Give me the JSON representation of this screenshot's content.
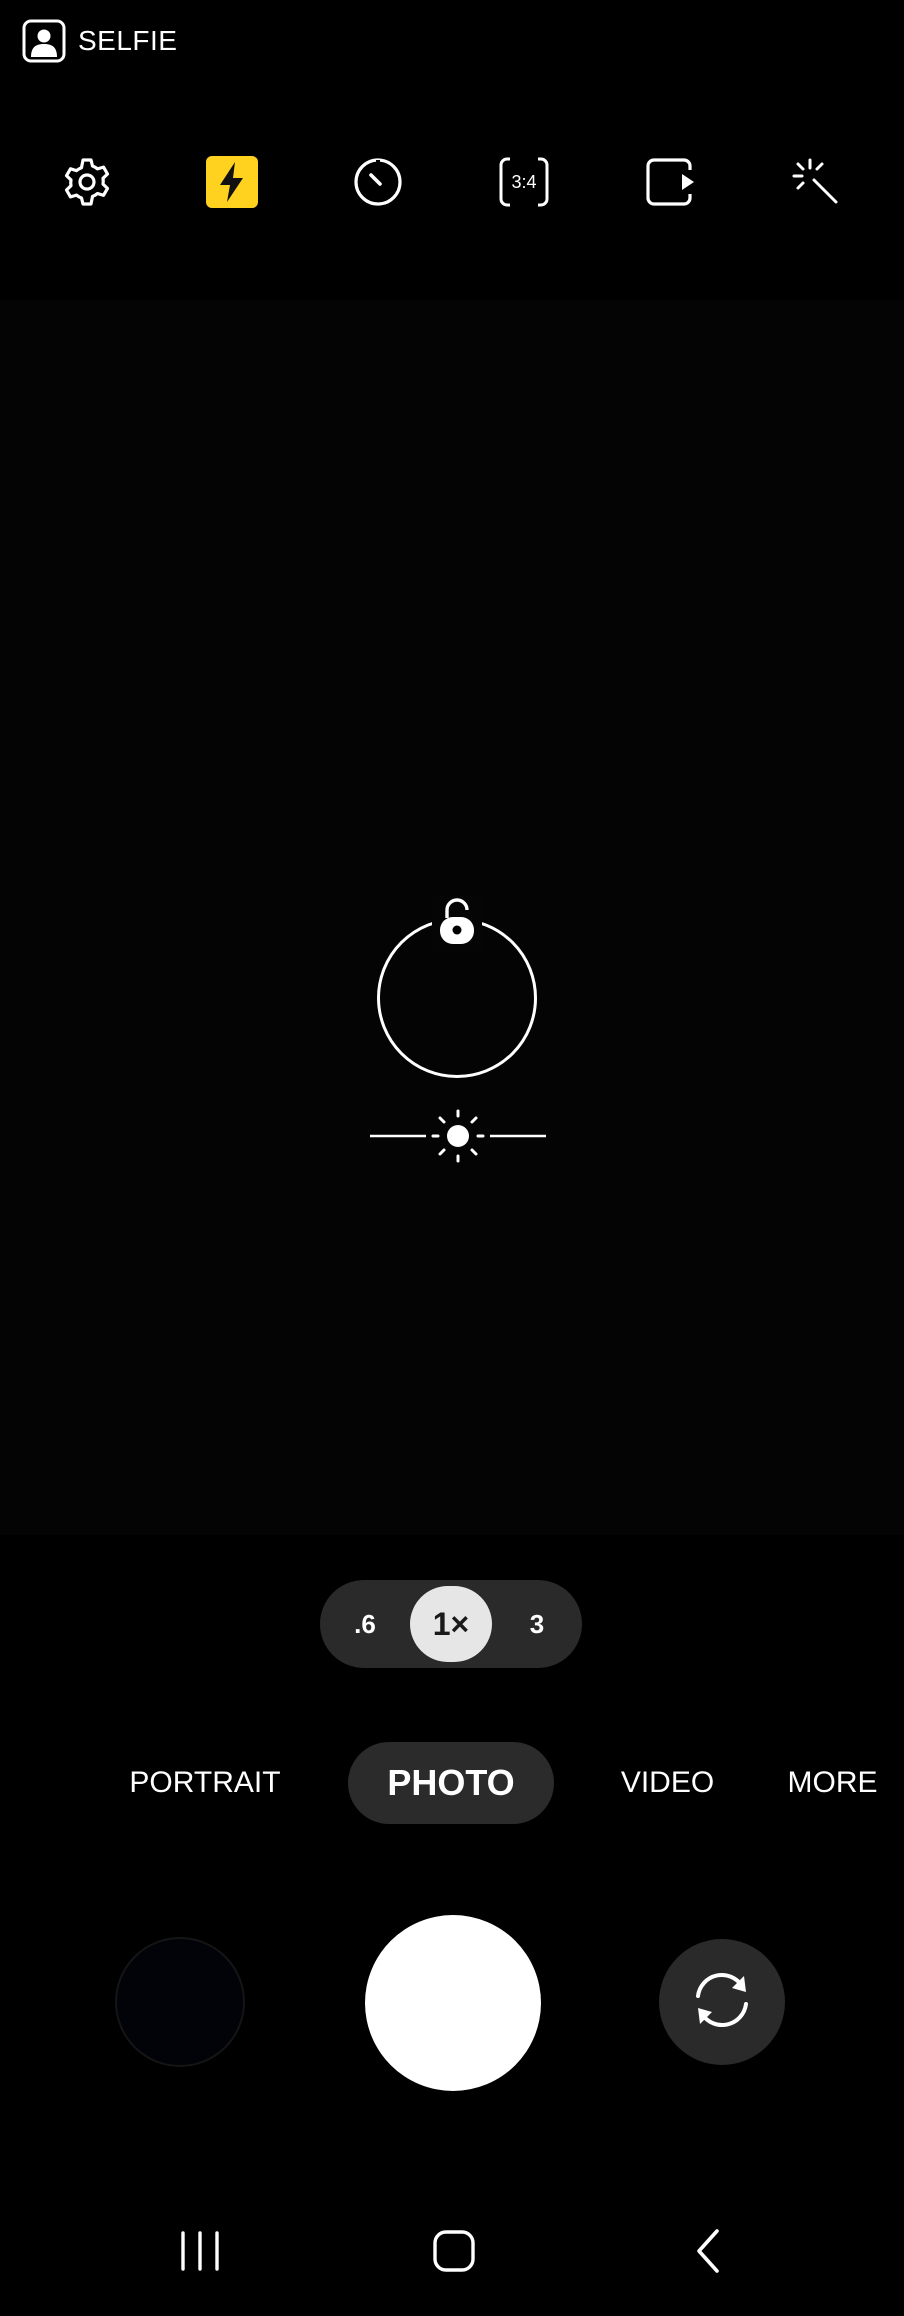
{
  "camera_facing": {
    "label": "SELFIE",
    "icon": "selfie-icon"
  },
  "toolbar": {
    "items": [
      {
        "name": "settings",
        "icon": "gear-icon"
      },
      {
        "name": "flash",
        "icon": "flash-icon",
        "active": true,
        "active_color": "#FFD21F"
      },
      {
        "name": "timer",
        "icon": "timer-icon"
      },
      {
        "name": "aspect-ratio",
        "icon": "aspect-ratio-icon",
        "label": "3:4"
      },
      {
        "name": "motion-photo",
        "icon": "motion-photo-icon"
      },
      {
        "name": "filters",
        "icon": "magic-wand-icon"
      }
    ]
  },
  "focus": {
    "lock_icon": "unlock-icon",
    "exposure_icon": "sun-icon"
  },
  "zoom": {
    "options": [
      ".6",
      "1×",
      "3"
    ],
    "selected": "1×"
  },
  "modes": {
    "items": [
      "PORTRAIT",
      "PHOTO",
      "VIDEO",
      "MORE"
    ],
    "selected": "PHOTO"
  },
  "capture": {
    "gallery_thumbnail": "gallery-thumbnail",
    "shutter": "shutter-button",
    "switch_camera_icon": "flip-camera-icon"
  },
  "navigation": {
    "buttons": [
      {
        "name": "recent-apps",
        "icon": "recents-icon"
      },
      {
        "name": "home",
        "icon": "home-icon"
      },
      {
        "name": "back",
        "icon": "back-icon"
      }
    ]
  },
  "colors": {
    "background": "#000000",
    "accent_flash": "#FFD21F",
    "pill_background": "#2A2A2A",
    "zoom_selected": "#E6E6E6"
  }
}
